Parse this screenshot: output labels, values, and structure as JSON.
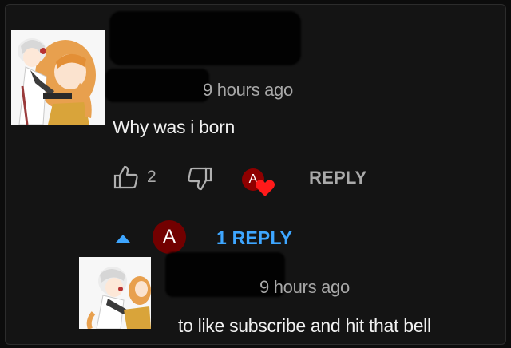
{
  "comment": {
    "timestamp": "9 hours ago",
    "text": "Why was i born",
    "like_count": "2",
    "reply_label": "REPLY",
    "creator_heart_avatar_letter": "A"
  },
  "replies_toggle": {
    "avatar_letter": "A",
    "label": "1 REPLY"
  },
  "reply": {
    "timestamp": "9 hours ago",
    "text": "to like subscribe and hit that bell"
  },
  "colors": {
    "background": "#141414",
    "text_primary": "#f1f1f1",
    "text_secondary": "#aaaaaa",
    "accent_blue": "#3ea6ff",
    "heart_red": "#ff1a1a",
    "avatar_red": "#8e0000"
  }
}
